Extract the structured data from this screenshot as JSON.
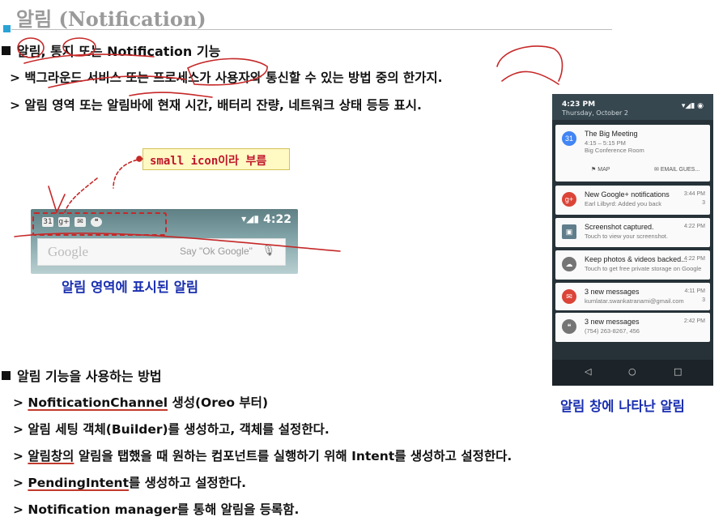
{
  "title": "알림 (Notification)",
  "section1": {
    "heading_parts": [
      "알림",
      ", ",
      "통지",
      " 또는 Notification 기능"
    ],
    "items": [
      "> 백그라운드 서비스 또는 프로세스가 사용자와 통신할 수 있는 방법 중의 한가지.",
      "> 알림 영역 또는 알림바에 현재 시간, 배터리 잔량, 네트워크 상태 등등 표시."
    ]
  },
  "callout": "small icon이라 부름",
  "statusbar": {
    "time": "4:22",
    "google_logo": "Google",
    "say_ok": "Say \"Ok Google\"",
    "icons": [
      "31",
      "g+",
      "mail",
      "hangouts"
    ]
  },
  "caption_left": "알림 영역에 표시된 알림",
  "caption_right": "알림 창에 나타난 알림",
  "phone": {
    "time": "4:23 PM",
    "date": "Thursday, October 2",
    "notifications": [
      {
        "title": "The Big Meeting",
        "line1": "4:15 – 5:15 PM",
        "line2": "Big Conference Room",
        "time": "",
        "count": "",
        "color": "#4285f4",
        "glyph": "31",
        "actions": [
          "MAP",
          "EMAIL GUES..."
        ]
      },
      {
        "title": "New Google+ notifications",
        "line1": "Earl Lilbyrd: Added you back",
        "time": "3:44 PM",
        "count": "3",
        "color": "#db4437",
        "glyph": "g+"
      },
      {
        "title": "Screenshot captured.",
        "line1": "Touch to view your screenshot.",
        "time": "4:22 PM",
        "count": "",
        "color": "#607d8b",
        "glyph": "▣"
      },
      {
        "title": "Keep photos & videos backed...",
        "line1": "Touch to get free private storage on Google",
        "time": "4:22 PM",
        "count": "",
        "color": "#757575",
        "glyph": "☁"
      },
      {
        "title": "3 new messages",
        "line1": "kumlatar.swankatranami@gmail.com",
        "time": "4:11 PM",
        "count": "3",
        "color": "#db4437",
        "glyph": "✉"
      },
      {
        "title": "3 new messages",
        "line1": "(754) 263-8267, 456",
        "time": "2:42 PM",
        "count": "",
        "color": "#757575",
        "glyph": "❝"
      }
    ],
    "nav": [
      "◁",
      "○",
      "□"
    ]
  },
  "section2": {
    "heading": "알림 기능을 사용하는 방법",
    "items": [
      {
        "prefix": "> ",
        "underlined": "NofiticationChannel",
        "rest": " 생성(Oreo 부터)"
      },
      {
        "prefix": "> ",
        "underlined": "",
        "rest": "알림 세팅 객체(Builder)를 생성하고, 객체를 설정한다."
      },
      {
        "prefix": "> ",
        "underlined": "알림창의",
        "rest": " 알림을 탭했을 때 원하는 컴포넌트를 실행하기 위해 Intent를 생성하고 설정한다."
      },
      {
        "prefix": "> ",
        "underlined": "PendingIntent",
        "rest": "를 생성하고 설정한다."
      },
      {
        "prefix": "> ",
        "underlined": "",
        "rest": "Notification manager를 통해 알림을 등록함."
      }
    ]
  },
  "colors": {
    "accent": "#29a3d6",
    "annotation": "#c62828",
    "caption": "#1a2fb0"
  }
}
